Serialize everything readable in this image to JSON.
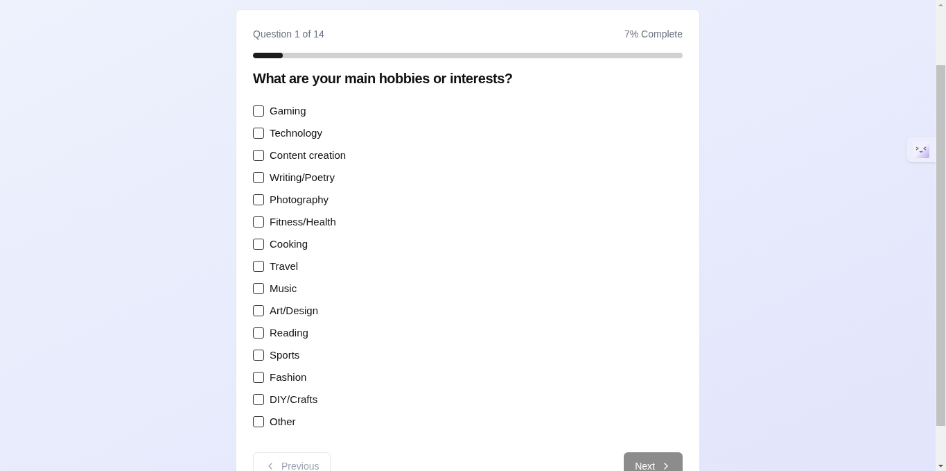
{
  "progress": {
    "counter": "Question 1 of 14",
    "percent": "7% Complete",
    "level": 0.07
  },
  "question": "What are your main hobbies or interests?",
  "options": [
    {
      "label": "Gaming",
      "checked": false
    },
    {
      "label": "Technology",
      "checked": false
    },
    {
      "label": "Content creation",
      "checked": false
    },
    {
      "label": "Writing/Poetry",
      "checked": false
    },
    {
      "label": "Photography",
      "checked": false
    },
    {
      "label": "Fitness/Health",
      "checked": false
    },
    {
      "label": "Cooking",
      "checked": false
    },
    {
      "label": "Travel",
      "checked": false
    },
    {
      "label": "Music",
      "checked": false
    },
    {
      "label": "Art/Design",
      "checked": false
    },
    {
      "label": "Reading",
      "checked": false
    },
    {
      "label": "Sports",
      "checked": false
    },
    {
      "label": "Fashion",
      "checked": false
    },
    {
      "label": "DIY/Crafts",
      "checked": false
    },
    {
      "label": "Other",
      "checked": false
    }
  ],
  "buttons": {
    "previous": {
      "label": "Previous",
      "disabled": true
    },
    "next": {
      "label": "Next",
      "disabled": true
    }
  }
}
